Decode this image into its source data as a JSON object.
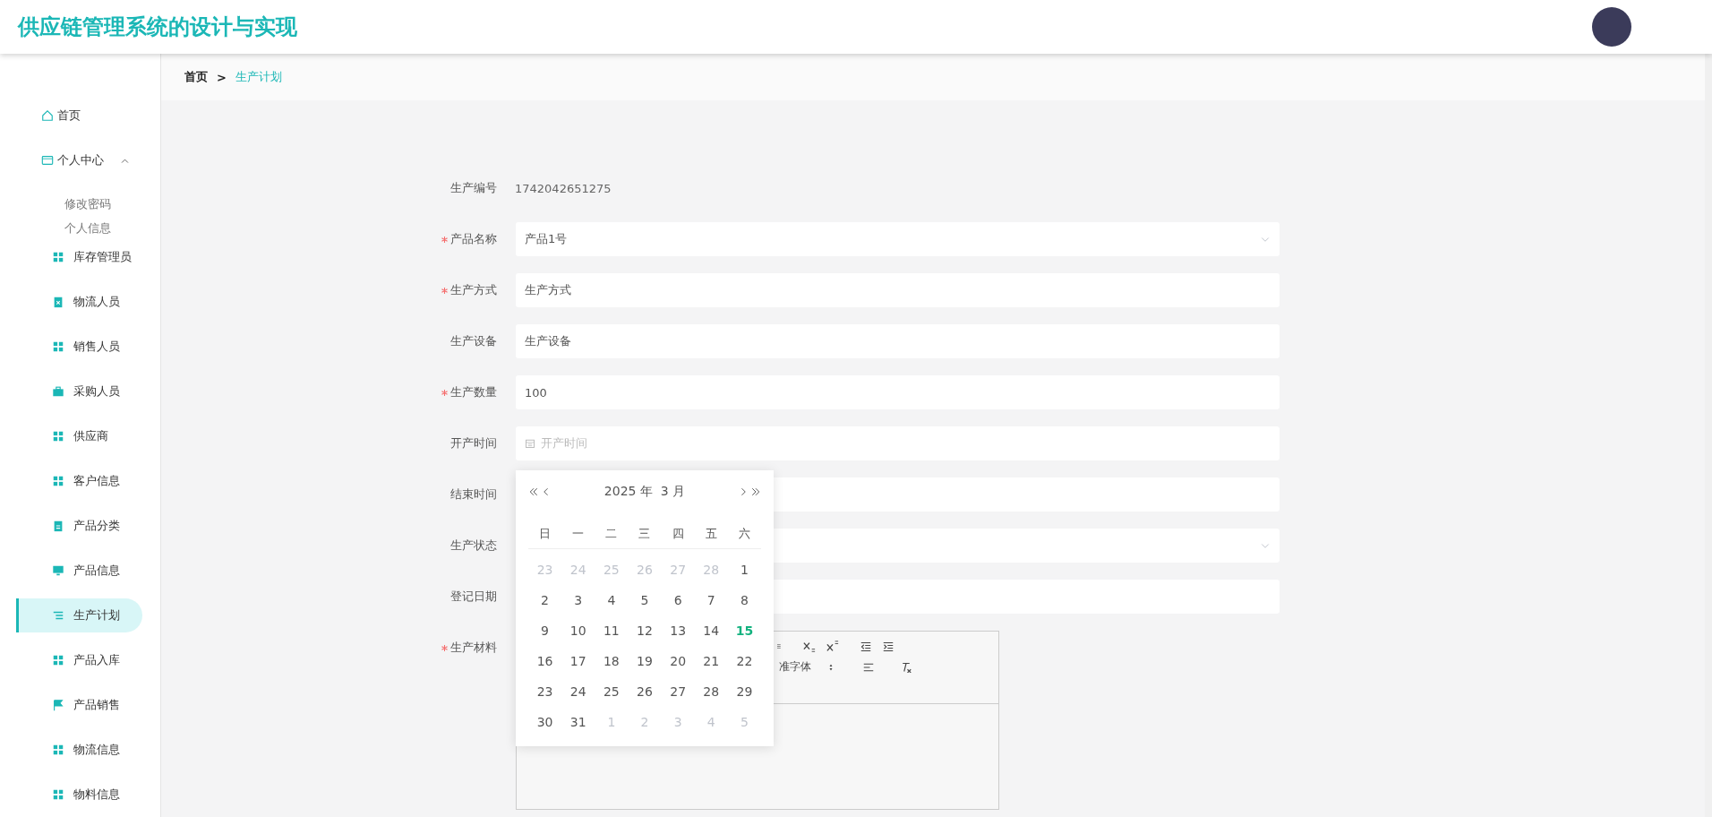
{
  "header": {
    "title": "供应链管理系统的设计与实现"
  },
  "breadcrumb": [
    {
      "label": "首页",
      "selected": false
    },
    {
      "label": "生产计划",
      "selected": true
    }
  ],
  "breadcrumb_separator": ">",
  "sidebar": {
    "items": [
      {
        "kind": "home",
        "label": "首页"
      },
      {
        "kind": "card",
        "label": "个人中心",
        "expanded": true,
        "children": [
          {
            "label": "修改密码"
          },
          {
            "label": "个人信息"
          }
        ]
      },
      {
        "kind": "grid",
        "label": "库存管理员",
        "selected": false
      },
      {
        "kind": "clipboard-x",
        "label": "物流人员",
        "selected": false
      },
      {
        "kind": "grid",
        "label": "销售人员",
        "selected": false
      },
      {
        "kind": "briefcase",
        "label": "采购人员",
        "selected": false
      },
      {
        "kind": "grid",
        "label": "供应商",
        "selected": false
      },
      {
        "kind": "grid",
        "label": "客户信息",
        "selected": false
      },
      {
        "kind": "clipboard",
        "label": "产品分类",
        "selected": false
      },
      {
        "kind": "monitor",
        "label": "产品信息",
        "selected": false
      },
      {
        "kind": "list",
        "label": "生产计划",
        "selected": true
      },
      {
        "kind": "grid",
        "label": "产品入库",
        "selected": false
      },
      {
        "kind": "flag",
        "label": "产品销售",
        "selected": false
      },
      {
        "kind": "grid",
        "label": "物流信息",
        "selected": false
      },
      {
        "kind": "grid",
        "label": "物料信息",
        "selected": false
      }
    ]
  },
  "form": {
    "fields": [
      {
        "kind": "static",
        "label": "生产编号",
        "required": false,
        "value": "1742042651275"
      },
      {
        "kind": "select",
        "label": "产品名称",
        "required": true,
        "value": "产品1号"
      },
      {
        "kind": "text",
        "label": "生产方式",
        "required": true,
        "value": "生产方式"
      },
      {
        "kind": "text",
        "label": "生产设备",
        "required": false,
        "value": "生产设备"
      },
      {
        "kind": "text",
        "label": "生产数量",
        "required": true,
        "value": "100"
      },
      {
        "kind": "date",
        "label": "开产时间",
        "required": false,
        "placeholder": "开产时间"
      },
      {
        "kind": "text",
        "label": "结束时间",
        "required": false
      },
      {
        "kind": "select",
        "label": "生产状态",
        "required": false
      },
      {
        "kind": "text",
        "label": "登记日期",
        "required": false
      },
      {
        "kind": "editor",
        "label": "生产材料",
        "required": true
      }
    ]
  },
  "editor": {
    "font_select": "准字体"
  },
  "calendar": {
    "title": "2025 年  3 月",
    "weekdays": [
      "日",
      "一",
      "二",
      "三",
      "四",
      "五",
      "六"
    ],
    "days": [
      {
        "label": "23",
        "kind": "other",
        "today": false
      },
      {
        "label": "24",
        "kind": "other",
        "today": false
      },
      {
        "label": "25",
        "kind": "other",
        "today": false
      },
      {
        "label": "26",
        "kind": "other",
        "today": false
      },
      {
        "label": "27",
        "kind": "other",
        "today": false
      },
      {
        "label": "28",
        "kind": "other",
        "today": false
      },
      {
        "label": "1",
        "kind": "current",
        "today": false
      },
      {
        "label": "2",
        "kind": "current",
        "today": false
      },
      {
        "label": "3",
        "kind": "current",
        "today": false
      },
      {
        "label": "4",
        "kind": "current",
        "today": false
      },
      {
        "label": "5",
        "kind": "current",
        "today": false
      },
      {
        "label": "6",
        "kind": "current",
        "today": false
      },
      {
        "label": "7",
        "kind": "current",
        "today": false
      },
      {
        "label": "8",
        "kind": "current",
        "today": false
      },
      {
        "label": "9",
        "kind": "current",
        "today": false
      },
      {
        "label": "10",
        "kind": "current",
        "today": false
      },
      {
        "label": "11",
        "kind": "current",
        "today": false
      },
      {
        "label": "12",
        "kind": "current",
        "today": false
      },
      {
        "label": "13",
        "kind": "current",
        "today": false
      },
      {
        "label": "14",
        "kind": "current",
        "today": false
      },
      {
        "label": "15",
        "kind": "current",
        "today": true
      },
      {
        "label": "16",
        "kind": "current",
        "today": false
      },
      {
        "label": "17",
        "kind": "current",
        "today": false
      },
      {
        "label": "18",
        "kind": "current",
        "today": false
      },
      {
        "label": "19",
        "kind": "current",
        "today": false
      },
      {
        "label": "20",
        "kind": "current",
        "today": false
      },
      {
        "label": "21",
        "kind": "current",
        "today": false
      },
      {
        "label": "22",
        "kind": "current",
        "today": false
      },
      {
        "label": "23",
        "kind": "current",
        "today": false
      },
      {
        "label": "24",
        "kind": "current",
        "today": false
      },
      {
        "label": "25",
        "kind": "current",
        "today": false
      },
      {
        "label": "26",
        "kind": "current",
        "today": false
      },
      {
        "label": "27",
        "kind": "current",
        "today": false
      },
      {
        "label": "28",
        "kind": "current",
        "today": false
      },
      {
        "label": "29",
        "kind": "current",
        "today": false
      },
      {
        "label": "30",
        "kind": "current",
        "today": false
      },
      {
        "label": "31",
        "kind": "current",
        "today": false
      },
      {
        "label": "1",
        "kind": "other",
        "today": false
      },
      {
        "label": "2",
        "kind": "other",
        "today": false
      },
      {
        "label": "3",
        "kind": "other",
        "today": false
      },
      {
        "label": "4",
        "kind": "other",
        "today": false
      },
      {
        "label": "5",
        "kind": "other",
        "today": false
      }
    ]
  }
}
